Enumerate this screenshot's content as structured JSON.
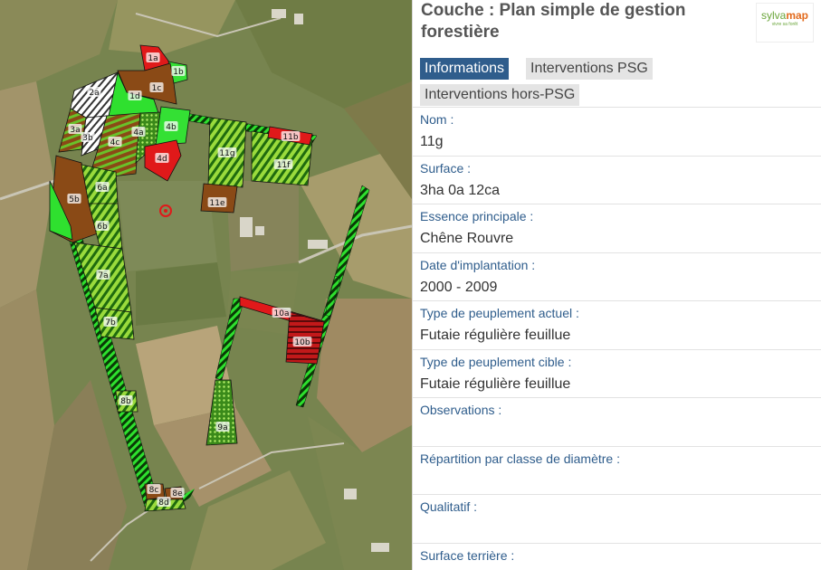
{
  "panel": {
    "title": "Couche : Plan simple de gestion forestière",
    "logo": {
      "part1": "sylva",
      "part2": "map",
      "tagline": "vivre sa forêt"
    },
    "tabs": [
      {
        "label": "Informations",
        "active": true
      },
      {
        "label": "Interventions PSG",
        "active": false
      },
      {
        "label": "Interventions hors-PSG",
        "active": false
      }
    ],
    "fields": [
      {
        "key": "Nom :",
        "value": "11g"
      },
      {
        "key": "Surface :",
        "value": "3ha 0a 12ca"
      },
      {
        "key": "Essence principale :",
        "value": "Chêne Rouvre"
      },
      {
        "key": "Date d'implantation :",
        "value": "2000 - 2009"
      },
      {
        "key": "Type de peuplement actuel :",
        "value": "Futaie régulière feuillue"
      },
      {
        "key": "Type de peuplement cible :",
        "value": "Futaie régulière feuillue"
      },
      {
        "key": "Observations :",
        "value": ""
      },
      {
        "key": "Répartition par classe de diamètre :",
        "value": ""
      },
      {
        "key": "Qualitatif :",
        "value": ""
      },
      {
        "key": "Surface terrière :",
        "value": ""
      }
    ]
  },
  "map": {
    "parcels": [
      {
        "label": "1a",
        "fill": "red"
      },
      {
        "label": "1b",
        "fill": "green"
      },
      {
        "label": "1c",
        "fill": "brown"
      },
      {
        "label": "1d",
        "fill": "green"
      },
      {
        "label": "2a",
        "fill": "white-hatch"
      },
      {
        "label": "3a",
        "fill": "brown-hatch"
      },
      {
        "label": "3b",
        "fill": "white-hatch"
      },
      {
        "label": "4a",
        "fill": "green-dots"
      },
      {
        "label": "4b",
        "fill": "green"
      },
      {
        "label": "4c",
        "fill": "brown-hatch"
      },
      {
        "label": "4d",
        "fill": "red"
      },
      {
        "label": "5b",
        "fill": "brown"
      },
      {
        "label": "6a",
        "fill": "green-hatch"
      },
      {
        "label": "6b",
        "fill": "green-hatch"
      },
      {
        "label": "7a",
        "fill": "green-hatch"
      },
      {
        "label": "7b",
        "fill": "green-hatch"
      },
      {
        "label": "8b",
        "fill": "green-hatch"
      },
      {
        "label": "8c",
        "fill": "brown"
      },
      {
        "label": "8d",
        "fill": "green-hatch"
      },
      {
        "label": "8e",
        "fill": "brown"
      },
      {
        "label": "9a",
        "fill": "green-dots"
      },
      {
        "label": "10a",
        "fill": "red"
      },
      {
        "label": "10b",
        "fill": "red-hatch"
      },
      {
        "label": "11b",
        "fill": "red"
      },
      {
        "label": "11e",
        "fill": "brown"
      },
      {
        "label": "11f",
        "fill": "green-hatch"
      },
      {
        "label": "11g",
        "fill": "green-hatch"
      }
    ],
    "marker": "location-target-icon"
  }
}
